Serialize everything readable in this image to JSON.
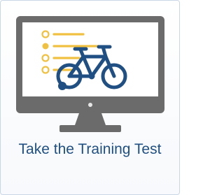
{
  "tile": {
    "label": "Take the Training Test",
    "icon": "monitor-bicycle-checklist-icon"
  },
  "colors": {
    "monitor_frame": "#6b6b6b",
    "screen": "#ffffff",
    "checklist": "#f0c040",
    "bicycle": "#1f4f83",
    "label": "#1f4f83",
    "border": "#c9d6e6"
  }
}
